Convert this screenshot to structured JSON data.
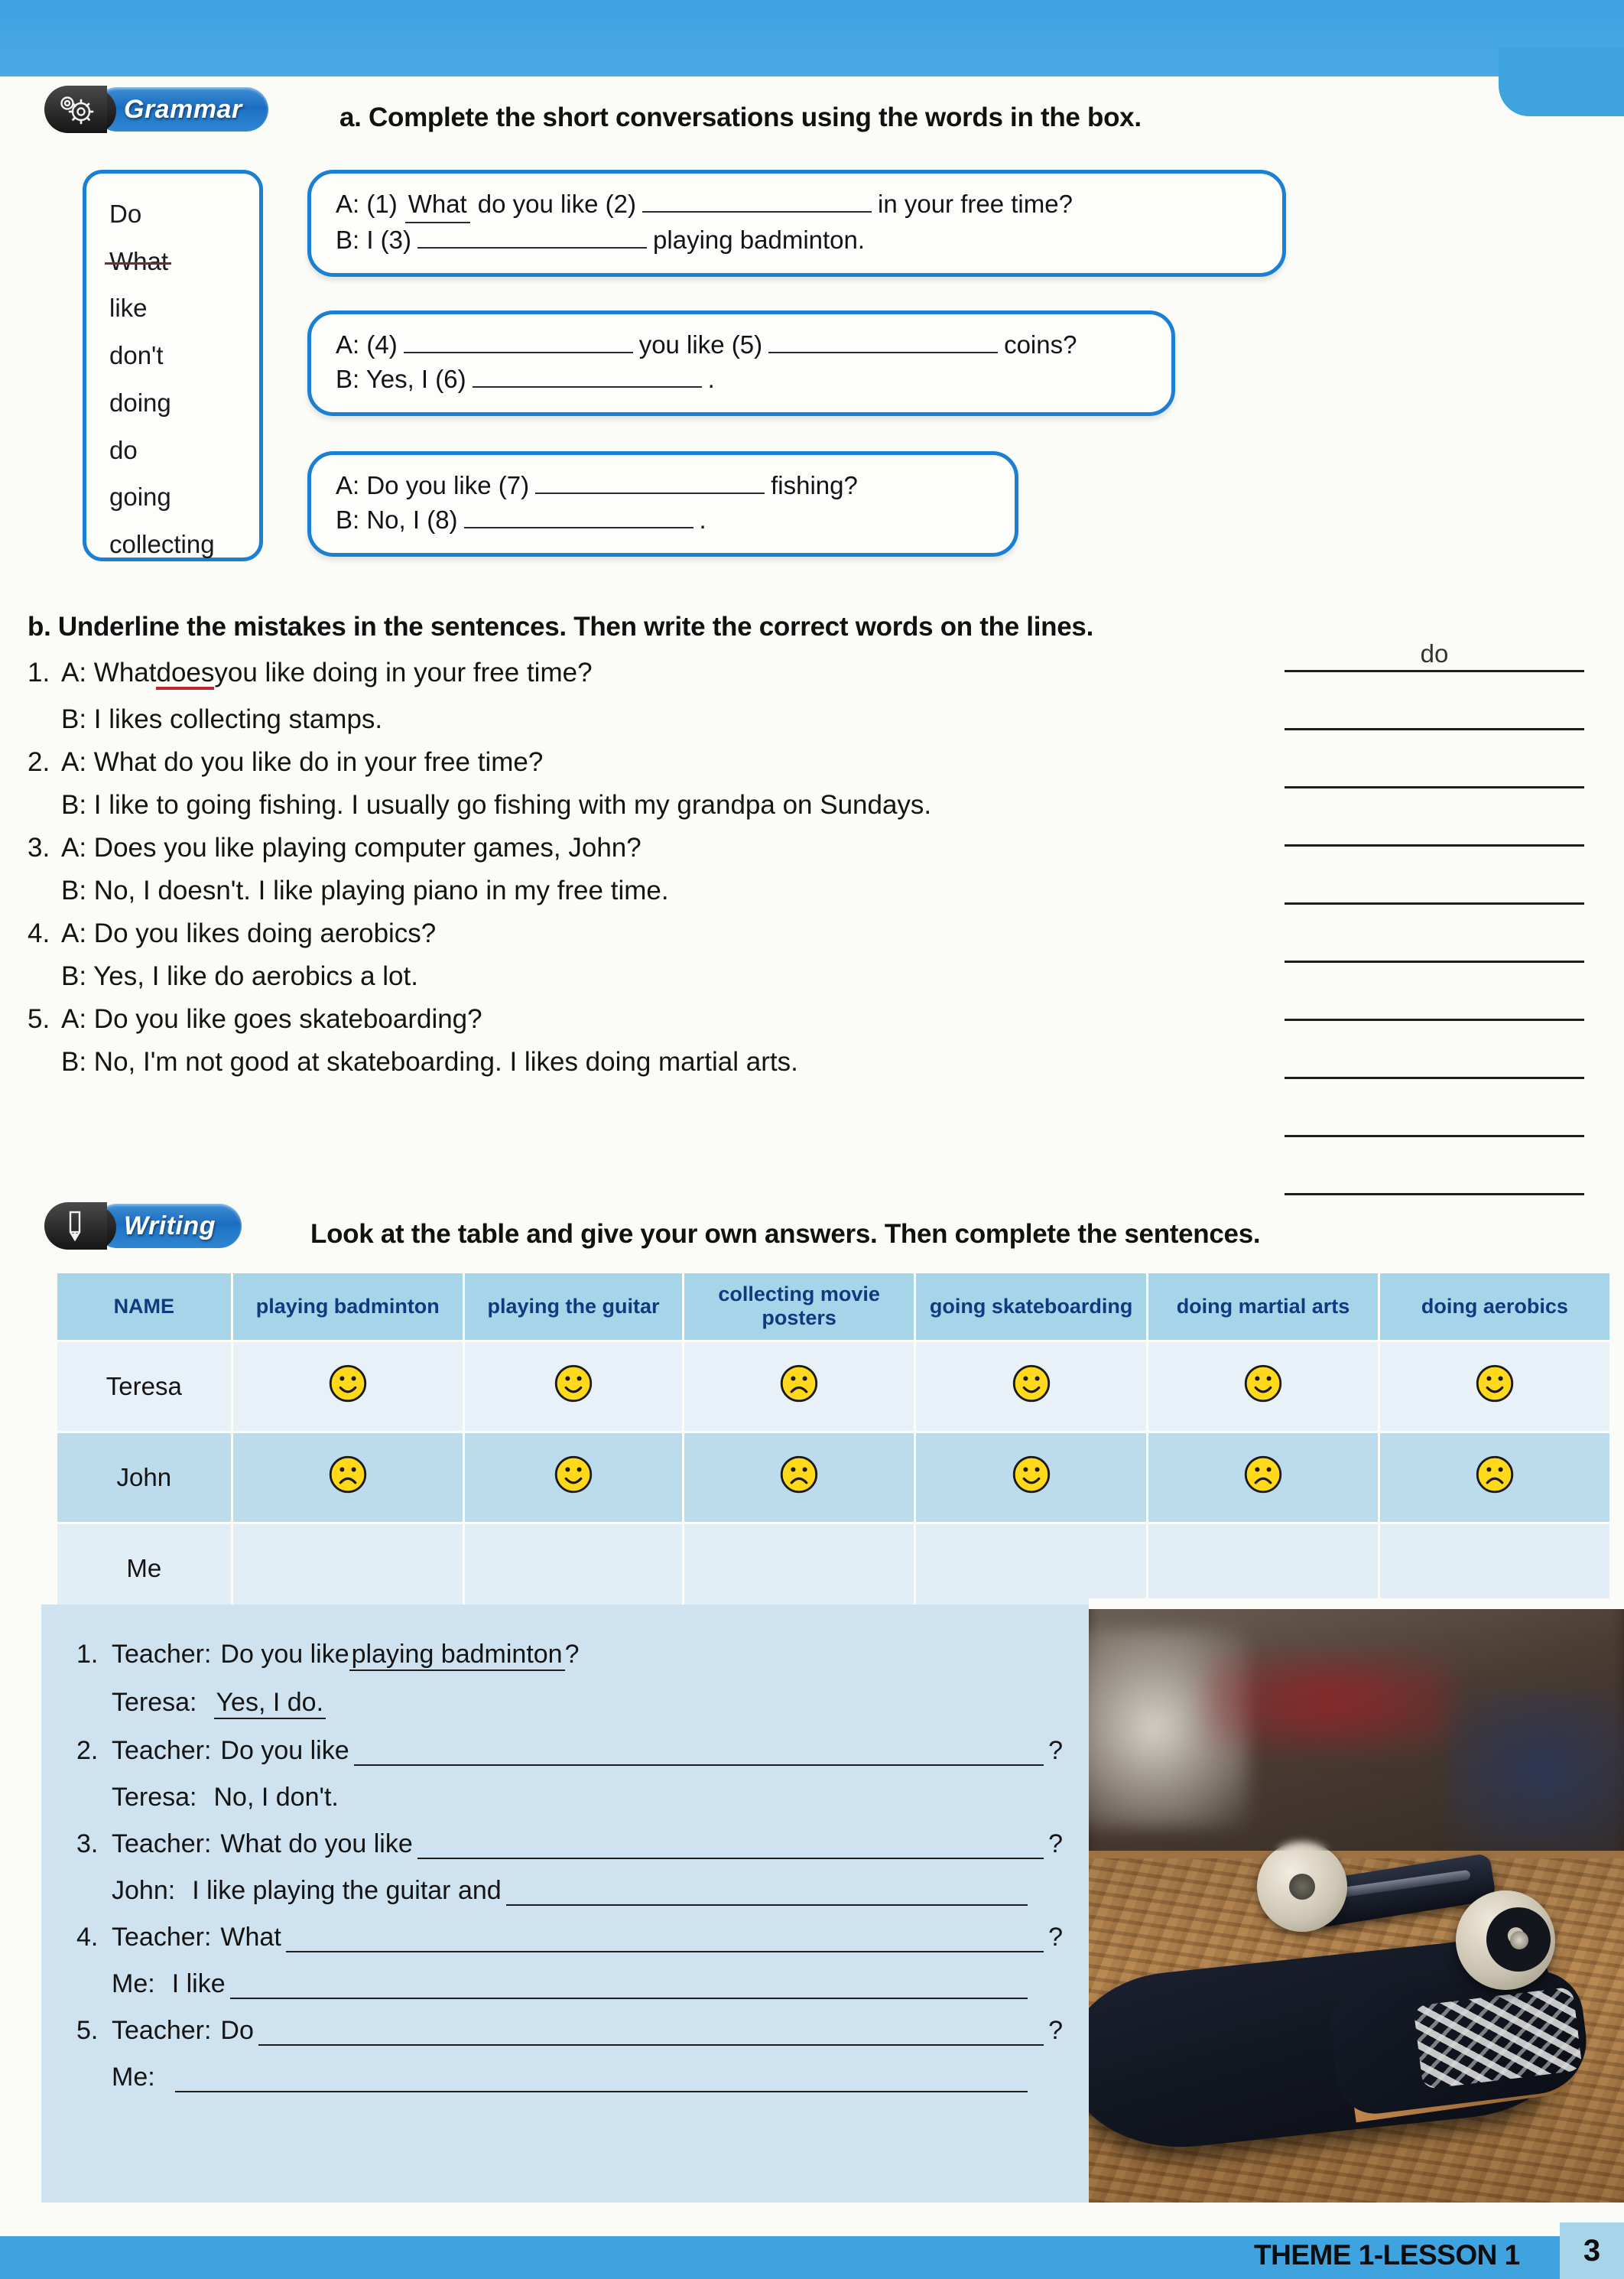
{
  "page": {
    "footer_theme": "THEME 1-LESSON 1",
    "page_number": "3",
    "accent_blue": "#3fa3e0",
    "bubble_border": "#1b7fd4",
    "table_header_bg": "#a6d5ea",
    "table_header_text": "#103a7e",
    "mistake_underline": "#c0272d"
  },
  "grammar_section": {
    "badge_label": "Grammar",
    "badge_icon": "gears-icon",
    "instruction": "a. Complete the short conversations using the words in the box.",
    "word_box": [
      {
        "word": "Do",
        "struck": false
      },
      {
        "word": "What",
        "struck": true
      },
      {
        "word": "like",
        "struck": false
      },
      {
        "word": "don't",
        "struck": false
      },
      {
        "word": "doing",
        "struck": false
      },
      {
        "word": "do",
        "struck": false
      },
      {
        "word": "going",
        "struck": false
      },
      {
        "word": "collecting",
        "struck": false
      }
    ],
    "bubbles": [
      {
        "line_a_pre": "A: (1)",
        "line_a_filled": "What",
        "line_a_mid": "do you like (2)",
        "line_a_post": "in your free time?",
        "line_b_pre": "B: I (3)",
        "line_b_post": "playing badminton."
      },
      {
        "line_a_pre": "A: (4)",
        "line_a_mid": "you like (5)",
        "line_a_post": "coins?",
        "line_b_pre": "B: Yes, I (6)",
        "line_b_post": "."
      },
      {
        "line_a_pre": "A: Do you like (7)",
        "line_a_post": "fishing?",
        "line_b_pre": "B: No, I (8)",
        "line_b_post": "."
      }
    ]
  },
  "mistakes_section": {
    "instruction": "b. Underline the mistakes in the sentences. Then write the correct words on the lines.",
    "items": [
      {
        "num": "1.",
        "a_pre": "A: What ",
        "a_mistake": "does",
        "a_post": " you like doing in your free time?",
        "b": "B: I likes collecting stamps."
      },
      {
        "num": "2.",
        "a_pre": "A: What do you like do in your free time?",
        "a_mistake": "",
        "a_post": "",
        "b": "B: I like to going fishing. I usually go fishing with my grandpa on Sundays."
      },
      {
        "num": "3.",
        "a_pre": "A: Does you like playing computer games, John?",
        "a_mistake": "",
        "a_post": "",
        "b": "B: No, I doesn't. I like playing piano in my free time."
      },
      {
        "num": "4.",
        "a_pre": "A: Do you likes doing aerobics?",
        "a_mistake": "",
        "a_post": "",
        "b": "B: Yes, I like do aerobics a lot."
      },
      {
        "num": "5.",
        "a_pre": "A: Do you like goes skateboarding?",
        "a_mistake": "",
        "a_post": "",
        "b": "B: No, I'm not good at skateboarding. I likes doing martial arts."
      }
    ],
    "answer_lines": [
      "do",
      "",
      "",
      "",
      "",
      "",
      "",
      "",
      "",
      ""
    ]
  },
  "writing_section": {
    "badge_label": "Writing",
    "badge_icon": "pencil-icon",
    "instruction": "Look at the table and give your own answers. Then complete the sentences.",
    "table": {
      "columns": [
        "NAME",
        "playing badminton",
        "playing the guitar",
        "collecting movie posters",
        "going skateboarding",
        "doing martial arts",
        "doing aerobics"
      ],
      "rows": [
        {
          "name": "Teresa",
          "faces": [
            "happy",
            "happy",
            "sad",
            "happy",
            "happy",
            "happy"
          ]
        },
        {
          "name": "John",
          "faces": [
            "sad",
            "happy",
            "sad",
            "happy",
            "sad",
            "sad"
          ]
        },
        {
          "name": "Me",
          "faces": [
            "",
            "",
            "",
            "",
            "",
            ""
          ]
        }
      ]
    },
    "exercises": [
      {
        "num": "1.",
        "q_speaker": "Teacher:",
        "q_pre": "Do you like ",
        "q_fill": "playing badminton",
        "q_post": "?",
        "q_blank": false,
        "a_speaker": "Teresa:",
        "a_pre": "",
        "a_fill": "Yes, I do.",
        "a_blank": false
      },
      {
        "num": "2.",
        "q_speaker": "Teacher:",
        "q_pre": "Do you like",
        "q_fill": "",
        "q_post": "?",
        "q_blank": true,
        "a_speaker": "Teresa:",
        "a_pre": "No, I don't.",
        "a_fill": "",
        "a_blank": false
      },
      {
        "num": "3.",
        "q_speaker": "Teacher:",
        "q_pre": "What do you like",
        "q_fill": "",
        "q_post": "?",
        "q_blank": true,
        "a_speaker": "John:",
        "a_pre": "I like playing the guitar and",
        "a_fill": "",
        "a_blank": true
      },
      {
        "num": "4.",
        "q_speaker": "Teacher:",
        "q_pre": "What",
        "q_fill": "",
        "q_post": "?",
        "q_blank": true,
        "a_speaker": "Me:",
        "a_pre": "I like",
        "a_fill": "",
        "a_blank": true
      },
      {
        "num": "5.",
        "q_speaker": "Teacher:",
        "q_pre": "Do",
        "q_fill": "",
        "q_post": "?",
        "q_blank": true,
        "a_speaker": "Me:",
        "a_pre": "",
        "a_fill": "",
        "a_blank": true
      }
    ]
  },
  "photo": {
    "caption": "skateboard-photo"
  }
}
